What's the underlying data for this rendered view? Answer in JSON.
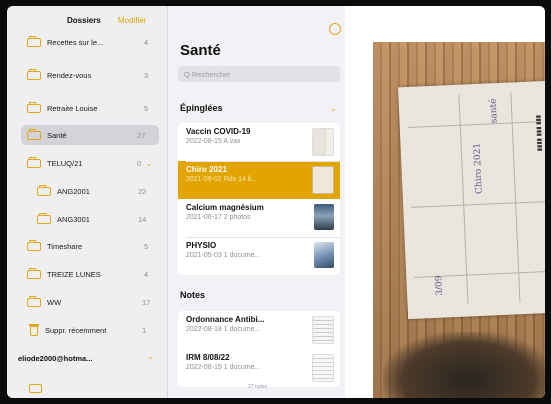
{
  "sidebar": {
    "title": "Dossiers",
    "edit_label": "Modifier",
    "folders": [
      {
        "label": "Recettes sur le...",
        "count": "4"
      },
      {
        "label": "Rendez-vous",
        "count": "3"
      },
      {
        "label": "Retraite Louise",
        "count": "5"
      },
      {
        "label": "Santé",
        "count": "27"
      },
      {
        "label": "TELUQ/21",
        "count": "0"
      },
      {
        "label": "ANG2001",
        "count": "22"
      },
      {
        "label": "ANG3001",
        "count": "14"
      },
      {
        "label": "Timeshare",
        "count": "5"
      },
      {
        "label": "TREIZE LUNES",
        "count": "4"
      },
      {
        "label": "WW",
        "count": "17"
      },
      {
        "label": "Suppr. récemment",
        "count": "1"
      }
    ],
    "account": "eliode2000@hotma...",
    "selected_folder": "Santé"
  },
  "notes_list": {
    "title": "Santé",
    "search_placeholder": "Q Rechercher",
    "pinned_header": "Épinglées",
    "notes_header": "Notes",
    "pinned": [
      {
        "title": "Vaccin COVID-19",
        "subtitle": "2022-08-15  A vax",
        "thumb": "document-thumbnail"
      },
      {
        "title": "Chiro 2021",
        "subtitle": "2021-09-02  Rdv 14 li...",
        "thumb": "document-thumbnail"
      },
      {
        "title": "Calcium magnésium",
        "subtitle": "2021-06-17  2 photos",
        "thumb": "photo-thumbnail"
      },
      {
        "title": "PHYSIO",
        "subtitle": "2021-05-03  1 docume...",
        "thumb": "photo-thumbnail"
      }
    ],
    "notes": [
      {
        "title": "Ordonnance Antibi...",
        "subtitle": "2022-08-18  1 docume...",
        "thumb": "document-thumbnail"
      },
      {
        "title": "IRM 8/08/22",
        "subtitle": "2022-08-15  1 docume...",
        "thumb": "document-thumbnail"
      }
    ],
    "footer_count": "27 notes",
    "selected_note": "Chiro 2021"
  },
  "detail": {
    "image": "scanned-receipt-photo",
    "handwriting": [
      "santé",
      "Chiro 2021",
      "3/09"
    ]
  },
  "colors": {
    "accent": "#e1a400",
    "sidebar_bg": "#efeff2",
    "list_bg": "#f2f2f6",
    "selected_folder_bg": "#d4d4d8"
  }
}
